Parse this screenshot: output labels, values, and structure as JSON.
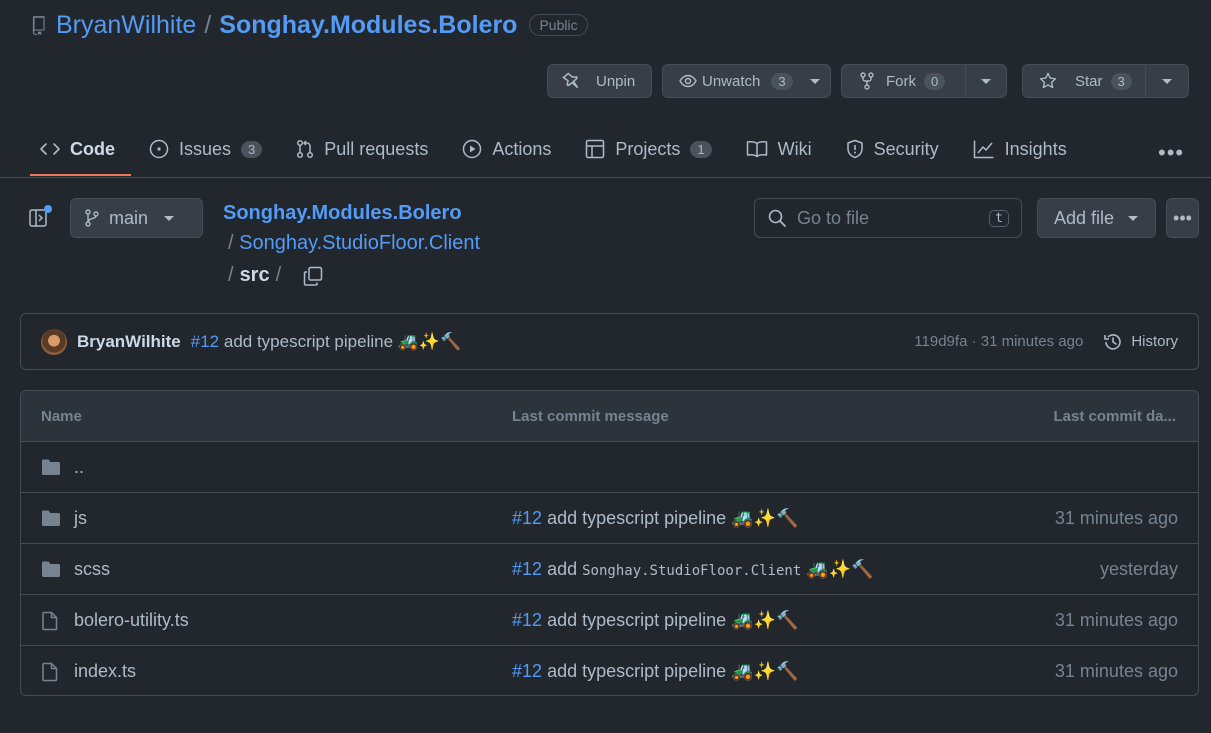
{
  "repo": {
    "owner": "BryanWilhite",
    "separator": "/",
    "name": "Songhay.Modules.Bolero",
    "visibility": "Public"
  },
  "actions": {
    "unpin": "Unpin",
    "unwatch": "Unwatch",
    "watch_count": "3",
    "fork": "Fork",
    "fork_count": "0",
    "star": "Star",
    "star_count": "3"
  },
  "tabs": [
    {
      "label": "Code",
      "icon": "code-icon",
      "active": true
    },
    {
      "label": "Issues",
      "icon": "issue-icon",
      "count": "3"
    },
    {
      "label": "Pull requests",
      "icon": "pull-request-icon"
    },
    {
      "label": "Actions",
      "icon": "play-icon"
    },
    {
      "label": "Projects",
      "icon": "table-icon",
      "count": "1"
    },
    {
      "label": "Wiki",
      "icon": "book-icon"
    },
    {
      "label": "Security",
      "icon": "shield-icon"
    },
    {
      "label": "Insights",
      "icon": "graph-icon"
    }
  ],
  "branch": "main",
  "breadcrumb": {
    "root": "Songhay.Modules.Bolero",
    "sep": "/",
    "folder": "Songhay.StudioFloor.Client",
    "current": "src"
  },
  "search": {
    "placeholder": "Go to file",
    "shortcut": "t"
  },
  "add_file": "Add file",
  "commit": {
    "author": "BryanWilhite",
    "issue": "#12",
    "message": "add typescript pipeline 🚜✨🔨",
    "hash": "119d9fa",
    "dot": "·",
    "time": "31 minutes ago",
    "history": "History"
  },
  "table": {
    "headers": {
      "name": "Name",
      "message": "Last commit message",
      "date": "Last commit da..."
    },
    "parent": "..",
    "rows": [
      {
        "name": "js",
        "type": "folder",
        "issue": "#12",
        "message": "add typescript pipeline 🚜✨🔨",
        "date": "31 minutes ago"
      },
      {
        "name": "scss",
        "type": "folder",
        "issue": "#12",
        "message_prefix": "add",
        "message_code": "Songhay.StudioFloor.Client",
        "message_suffix": "🚜✨🔨",
        "date": "yesterday"
      },
      {
        "name": "bolero-utility.ts",
        "type": "file",
        "issue": "#12",
        "message": "add typescript pipeline 🚜✨🔨",
        "date": "31 minutes ago"
      },
      {
        "name": "index.ts",
        "type": "file",
        "issue": "#12",
        "message": "add typescript pipeline 🚜✨🔨",
        "date": "31 minutes ago"
      }
    ]
  },
  "colors": {
    "accent": "#539bf5",
    "active_tab_underline": "#ec775c",
    "background": "#22272e"
  }
}
